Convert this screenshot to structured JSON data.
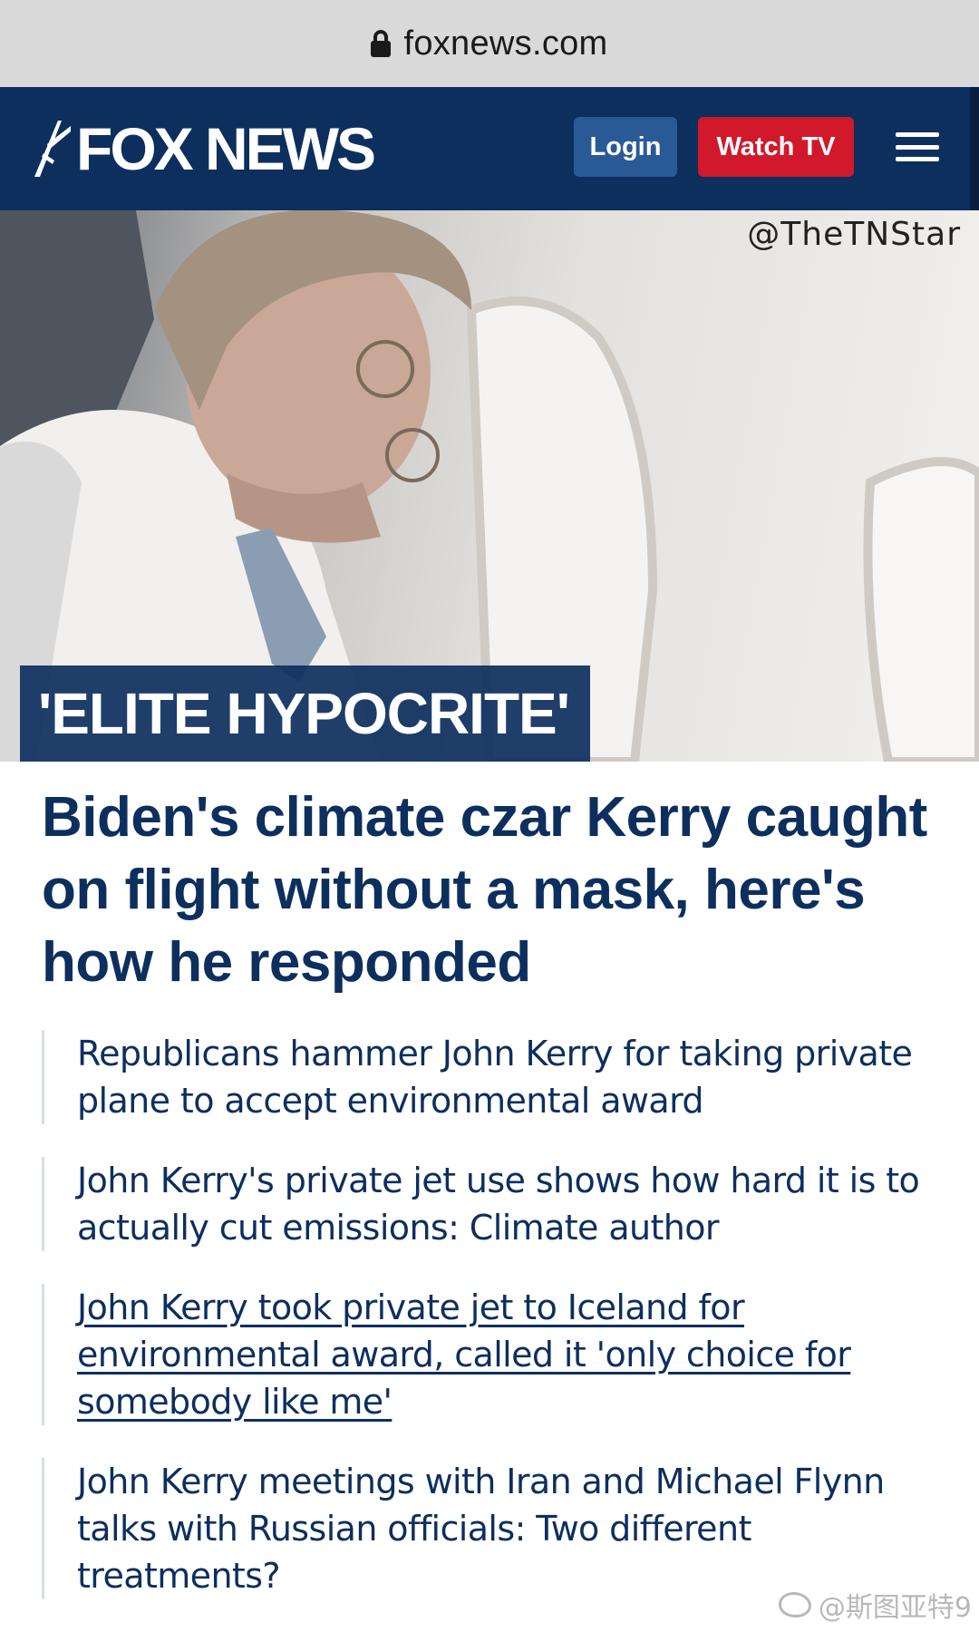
{
  "browser": {
    "url": "foxnews.com",
    "lock_icon": "lock-icon"
  },
  "header": {
    "logo_text": "FOX NEWS",
    "login_label": "Login",
    "watch_label": "Watch TV",
    "menu_icon": "hamburger-menu-icon",
    "colors": {
      "navy": "#0d2f5e",
      "login": "#2a5a96",
      "watch": "#d2182b"
    }
  },
  "hero": {
    "watermark": "@TheTNStar",
    "kicker": "'ELITE HYPOCRITE'"
  },
  "article": {
    "headline": "Biden's climate czar Kerry caught on flight without a mask, here's how he responded"
  },
  "related": [
    {
      "text": "Republicans hammer John Kerry for taking private plane to accept environmental award"
    },
    {
      "text": "John Kerry's private jet use shows how hard it is to actually cut emissions: Climate author"
    },
    {
      "text": "John Kerry took private jet to Iceland for environmental award, called it 'only choice for somebody like me'"
    },
    {
      "text": "John Kerry meetings with Iran and Michael Flynn talks with Russian officials: Two different treatments?"
    }
  ],
  "footer_watermark": "@斯图亚特9"
}
